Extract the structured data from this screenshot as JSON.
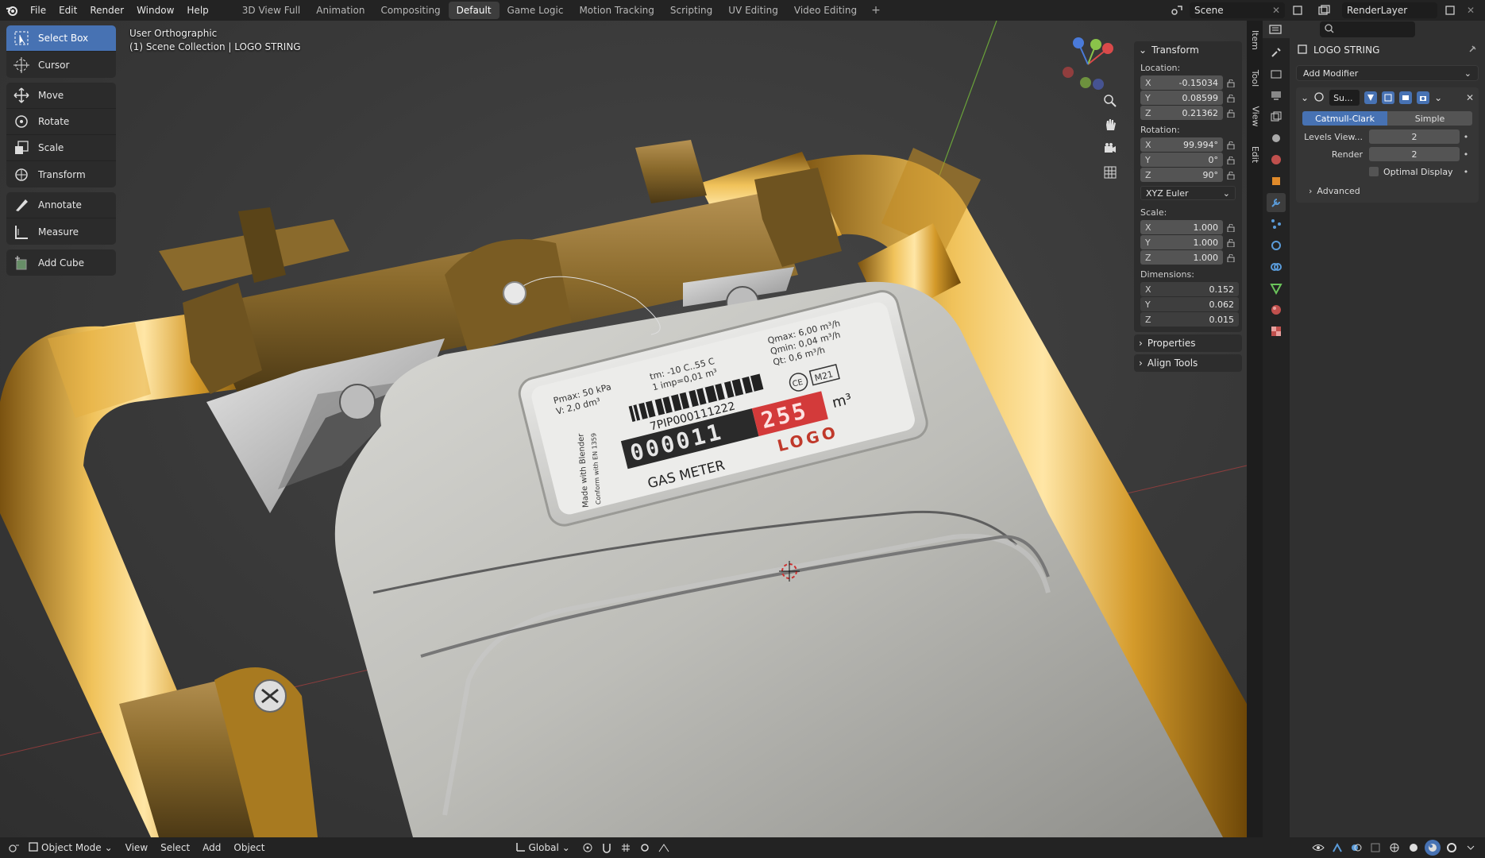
{
  "topbar": {
    "menus": [
      "File",
      "Edit",
      "Render",
      "Window",
      "Help"
    ],
    "workspace_tabs": [
      "3D View Full",
      "Animation",
      "Compositing",
      "Default",
      "Game Logic",
      "Motion Tracking",
      "Scripting",
      "UV Editing",
      "Video Editing"
    ],
    "active_tab": "Default",
    "scene_name": "Scene",
    "view_layer": "RenderLayer"
  },
  "viewport": {
    "view_name": "User Orthographic",
    "collection_path": "(1) Scene Collection | LOGO STRING",
    "meter_label": {
      "pmax": "Pmax: 50 kPa",
      "v": "V: 2,0 dm³",
      "tm": "tm: -10 C..55 C",
      "imp": "1 imp=0,01 m³",
      "qmax": "Qmax: 6,00 m³/h",
      "qmin": "Qmin: 0,04 m³/h",
      "qt": "Qt: 0,6 m³/h",
      "serial": "7PIP000111222",
      "digits_black": "000011",
      "digits_red": "255",
      "unit": "m³",
      "gas_meter": "GAS METER",
      "logo": "LOGO",
      "ce": "CE",
      "m21": "M21",
      "made": "Made with Blender",
      "conform": "Conform with EN 1359"
    }
  },
  "toolbar": {
    "tools": [
      {
        "label": "Select Box",
        "icon": "select-box-icon"
      },
      {
        "label": "Cursor",
        "icon": "cursor-icon"
      },
      {
        "label": "Move",
        "icon": "move-icon"
      },
      {
        "label": "Rotate",
        "icon": "rotate-icon"
      },
      {
        "label": "Scale",
        "icon": "scale-icon"
      },
      {
        "label": "Transform",
        "icon": "transform-icon"
      },
      {
        "label": "Annotate",
        "icon": "annotate-icon"
      },
      {
        "label": "Measure",
        "icon": "measure-icon"
      },
      {
        "label": "Add Cube",
        "icon": "add-cube-icon"
      }
    ],
    "active": "Select Box"
  },
  "npanel": {
    "title": "Transform",
    "location_label": "Location:",
    "location": {
      "x": "-0.15034",
      "y": "0.08599",
      "z": "0.21362"
    },
    "rotation_label": "Rotation:",
    "rotation": {
      "x": "99.994°",
      "y": "0°",
      "z": "90°"
    },
    "rotation_mode": "XYZ Euler",
    "scale_label": "Scale:",
    "scale": {
      "x": "1.000",
      "y": "1.000",
      "z": "1.000"
    },
    "dimensions_label": "Dimensions:",
    "dimensions": {
      "x": "0.152",
      "y": "0.062",
      "z": "0.015"
    },
    "axes": {
      "x": "X",
      "y": "Y",
      "z": "Z"
    },
    "properties": "Properties",
    "align_tools": "Align Tools"
  },
  "sidetabs": [
    "Item",
    "Tool",
    "View",
    "Edit"
  ],
  "properties": {
    "object_name": "LOGO STRING",
    "add_modifier": "Add Modifier",
    "modifier_name": "Su...",
    "catmull": "Catmull-Clark",
    "simple": "Simple",
    "levels_label": "Levels View...",
    "levels_value": "2",
    "render_label": "Render",
    "render_value": "2",
    "optimal": "Optimal Display",
    "advanced": "Advanced"
  },
  "bottombar": {
    "mode": "Object Mode",
    "menus": [
      "View",
      "Select",
      "Add",
      "Object"
    ],
    "orientation": "Global"
  },
  "colors": {
    "accent": "#4772b3",
    "pipe": "#d19a2a",
    "brass": "#8a6a2c",
    "meter": "#c8c8c4"
  }
}
